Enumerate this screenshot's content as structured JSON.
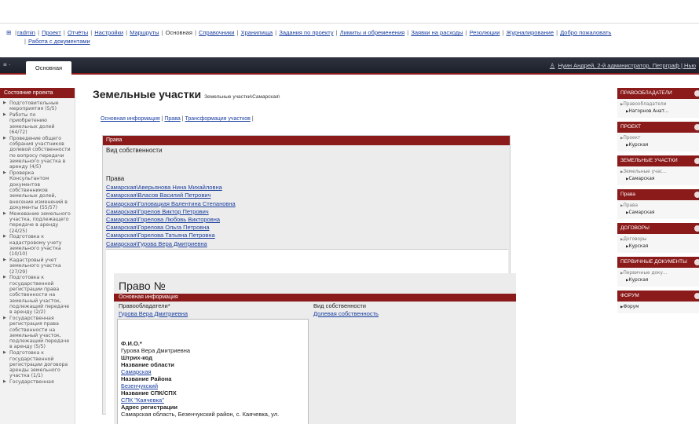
{
  "menu": {
    "icon": "grid-icon",
    "items": [
      "radmin",
      "Проект",
      "Отчёты",
      "Настройки",
      "Маршруты",
      "Основная",
      "Справочники",
      "Хранилища",
      "Задания по проекту",
      "Лимиты и обременения",
      "Заявки на расходы",
      "Резолюции",
      "Журналирование",
      "Добро пожаловать"
    ],
    "current_index": 5,
    "row2": "Работа с документами"
  },
  "navbar": {
    "menu_icon": "≡ ·",
    "tab": "Основная",
    "user": "Нуин Андрей, 2-й администратор, Петрграф | Нью"
  },
  "left": {
    "header": "Состояние проекта",
    "items": [
      "Подготовительные мероприятия (5/5)",
      "Работы по приобретению земельных долей (64/72)",
      "Проведение общего собрания участников долевой собственности по вопросу передачи земельного участка в аренду (4/5)",
      "Проверка Консультантом документов собственников земельных долей, внесение изменений в документы (55/57)",
      "Межевание земельного участка, подлежащего передаче в аренду (24/25)",
      "Подготовка к кадастровому учету земельного участка (10/10)",
      "Кадастровый учет земельного участка (27/29)",
      "Подготовка к государственной регистрации права собственности на земельный участок, подлежащий передаче в аренду (2/2)",
      "Государственная регистрация права собственности на земельный участок, подлежащий передаче в аренду (5/5)",
      "Подготовка к государственной регистрации договора аренды земельного участка (1/1)",
      "Государственная"
    ]
  },
  "main": {
    "title": "Земельные участки",
    "subtitle": "Земельные участки\\Самарская\\",
    "links": [
      "Основная информация",
      "Права",
      "Трансформация участков"
    ],
    "section": {
      "bar": "Права",
      "vid_label": "Вид собственности",
      "rights_title": "Права",
      "rights": [
        "Самарская\\Аверьянова Нина Михайловна",
        "Самарская\\Власов Василий Петрович",
        "Самарская\\Головацкая Валентина Степановна",
        "Самарская\\Горелов Виктор Петрович",
        "Самарская\\Горелова Любовь Викторовна",
        "Самарская\\Горелова Ольга Петровна",
        "Самарская\\Горелова Татьяна Петровна",
        "Самарская\\Гурова Вера Дмитриевна"
      ]
    },
    "detail": {
      "title": "Право №",
      "bar": "Основная информация",
      "holder_label": "Правообладатели*",
      "holder_value": "Гурова Вера Дмитриевна",
      "type_label": "Вид собственности",
      "type_value": "Долевая собственность",
      "card": {
        "fio_label": "Ф.И.О.*",
        "fio_value": "Гурова Вера Дмитриевна",
        "barcode_label": "Штрих-код",
        "region_label": "Название области",
        "region_value": "Самарская",
        "district_label": "Название Района",
        "district_value": "Безенчукский",
        "spk_label": "Название СПК/СПХ",
        "spk_value": "СПК \"Каячевка\"",
        "address_label": "Адрес регистрации",
        "address_value": "Самарская область, Безенчукский район, с. Каячевка, ул."
      }
    }
  },
  "right": [
    {
      "header": "ПРАВООБЛАДАТЕЛИ",
      "sub": "Правообладатели",
      "item": "Нагорнов Анат..."
    },
    {
      "header": "ПРОЕКТ",
      "sub": "Проект",
      "item": "Курская"
    },
    {
      "header": "ЗЕМЕЛЬНЫЕ УЧАСТКИ",
      "sub": "Земельные учас...",
      "item": "Самарская"
    },
    {
      "header": "Права",
      "sub": "Права",
      "item": "Самарская"
    },
    {
      "header": "ДОГОВОРЫ",
      "sub": "Договоры",
      "item": "Курская"
    },
    {
      "header": "ПЕРВИЧНЫЕ ДОКУМЕНТЫ",
      "sub": "Первичные доку...",
      "item": "Курская"
    },
    {
      "header": "ФОРУМ",
      "sub": "",
      "item": "Форум"
    }
  ]
}
